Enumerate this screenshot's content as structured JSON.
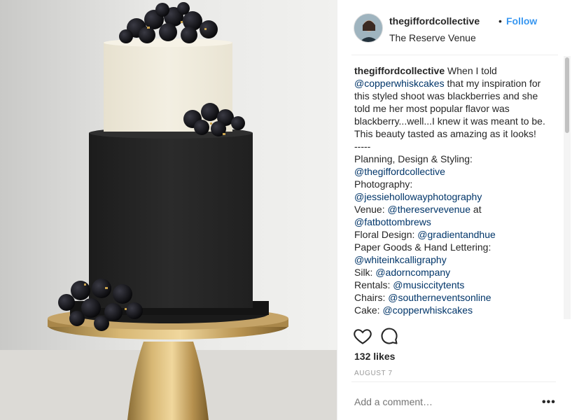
{
  "post": {
    "image_alt": "Two-tier cake with ivory top tier, black bottom tier and blackberries on a gold cake stand",
    "username": "thegiffordcollective",
    "separator": "•",
    "follow_label": "Follow",
    "location": "The Reserve Venue",
    "caption": {
      "author": "thegiffordcollective",
      "segments": [
        {
          "t": "text",
          "v": "When I told "
        },
        {
          "t": "mention",
          "v": "@copperwhiskcakes"
        },
        {
          "t": "text",
          "v": " that my inspiration for this styled shoot was blackberries and she told me her most popular flavor was blackberry...well...I knew it was meant to be. This beauty tasted as amazing as it looks!"
        },
        {
          "t": "br"
        },
        {
          "t": "text",
          "v": "-----"
        },
        {
          "t": "br"
        },
        {
          "t": "text",
          "v": "Planning, Design & Styling:"
        },
        {
          "t": "br"
        },
        {
          "t": "mention",
          "v": "@thegiffordcollective"
        },
        {
          "t": "br"
        },
        {
          "t": "text",
          "v": "Photography:"
        },
        {
          "t": "br"
        },
        {
          "t": "mention",
          "v": "@jessiehollowayphotography"
        },
        {
          "t": "br"
        },
        {
          "t": "text",
          "v": "Venue: "
        },
        {
          "t": "mention",
          "v": "@thereservevenue"
        },
        {
          "t": "text",
          "v": " at"
        },
        {
          "t": "br"
        },
        {
          "t": "mention",
          "v": "@fatbottombrews"
        },
        {
          "t": "br"
        },
        {
          "t": "text",
          "v": "Floral Design: "
        },
        {
          "t": "mention",
          "v": "@gradientandhue"
        },
        {
          "t": "br"
        },
        {
          "t": "text",
          "v": "Paper Goods & Hand Lettering:"
        },
        {
          "t": "br"
        },
        {
          "t": "mention",
          "v": "@whiteinkcalligraphy"
        },
        {
          "t": "br"
        },
        {
          "t": "text",
          "v": "Silk: "
        },
        {
          "t": "mention",
          "v": "@adorncompany"
        },
        {
          "t": "br"
        },
        {
          "t": "text",
          "v": "Rentals: "
        },
        {
          "t": "mention",
          "v": "@musiccitytents"
        },
        {
          "t": "br"
        },
        {
          "t": "text",
          "v": "Chairs: "
        },
        {
          "t": "mention",
          "v": "@southerneventsonline"
        },
        {
          "t": "br"
        },
        {
          "t": "text",
          "v": "Cake: "
        },
        {
          "t": "mention",
          "v": "@copperwhiskcakes"
        }
      ]
    },
    "likes": "132 likes",
    "date": "AUGUST 7",
    "comment_placeholder": "Add a comment…",
    "more_label": "•••",
    "icons": {
      "like": "heart-icon",
      "comment": "speech-bubble-icon"
    },
    "colors": {
      "link": "#3897f0",
      "mention": "#003569",
      "muted": "#999999",
      "text": "#262626"
    }
  }
}
